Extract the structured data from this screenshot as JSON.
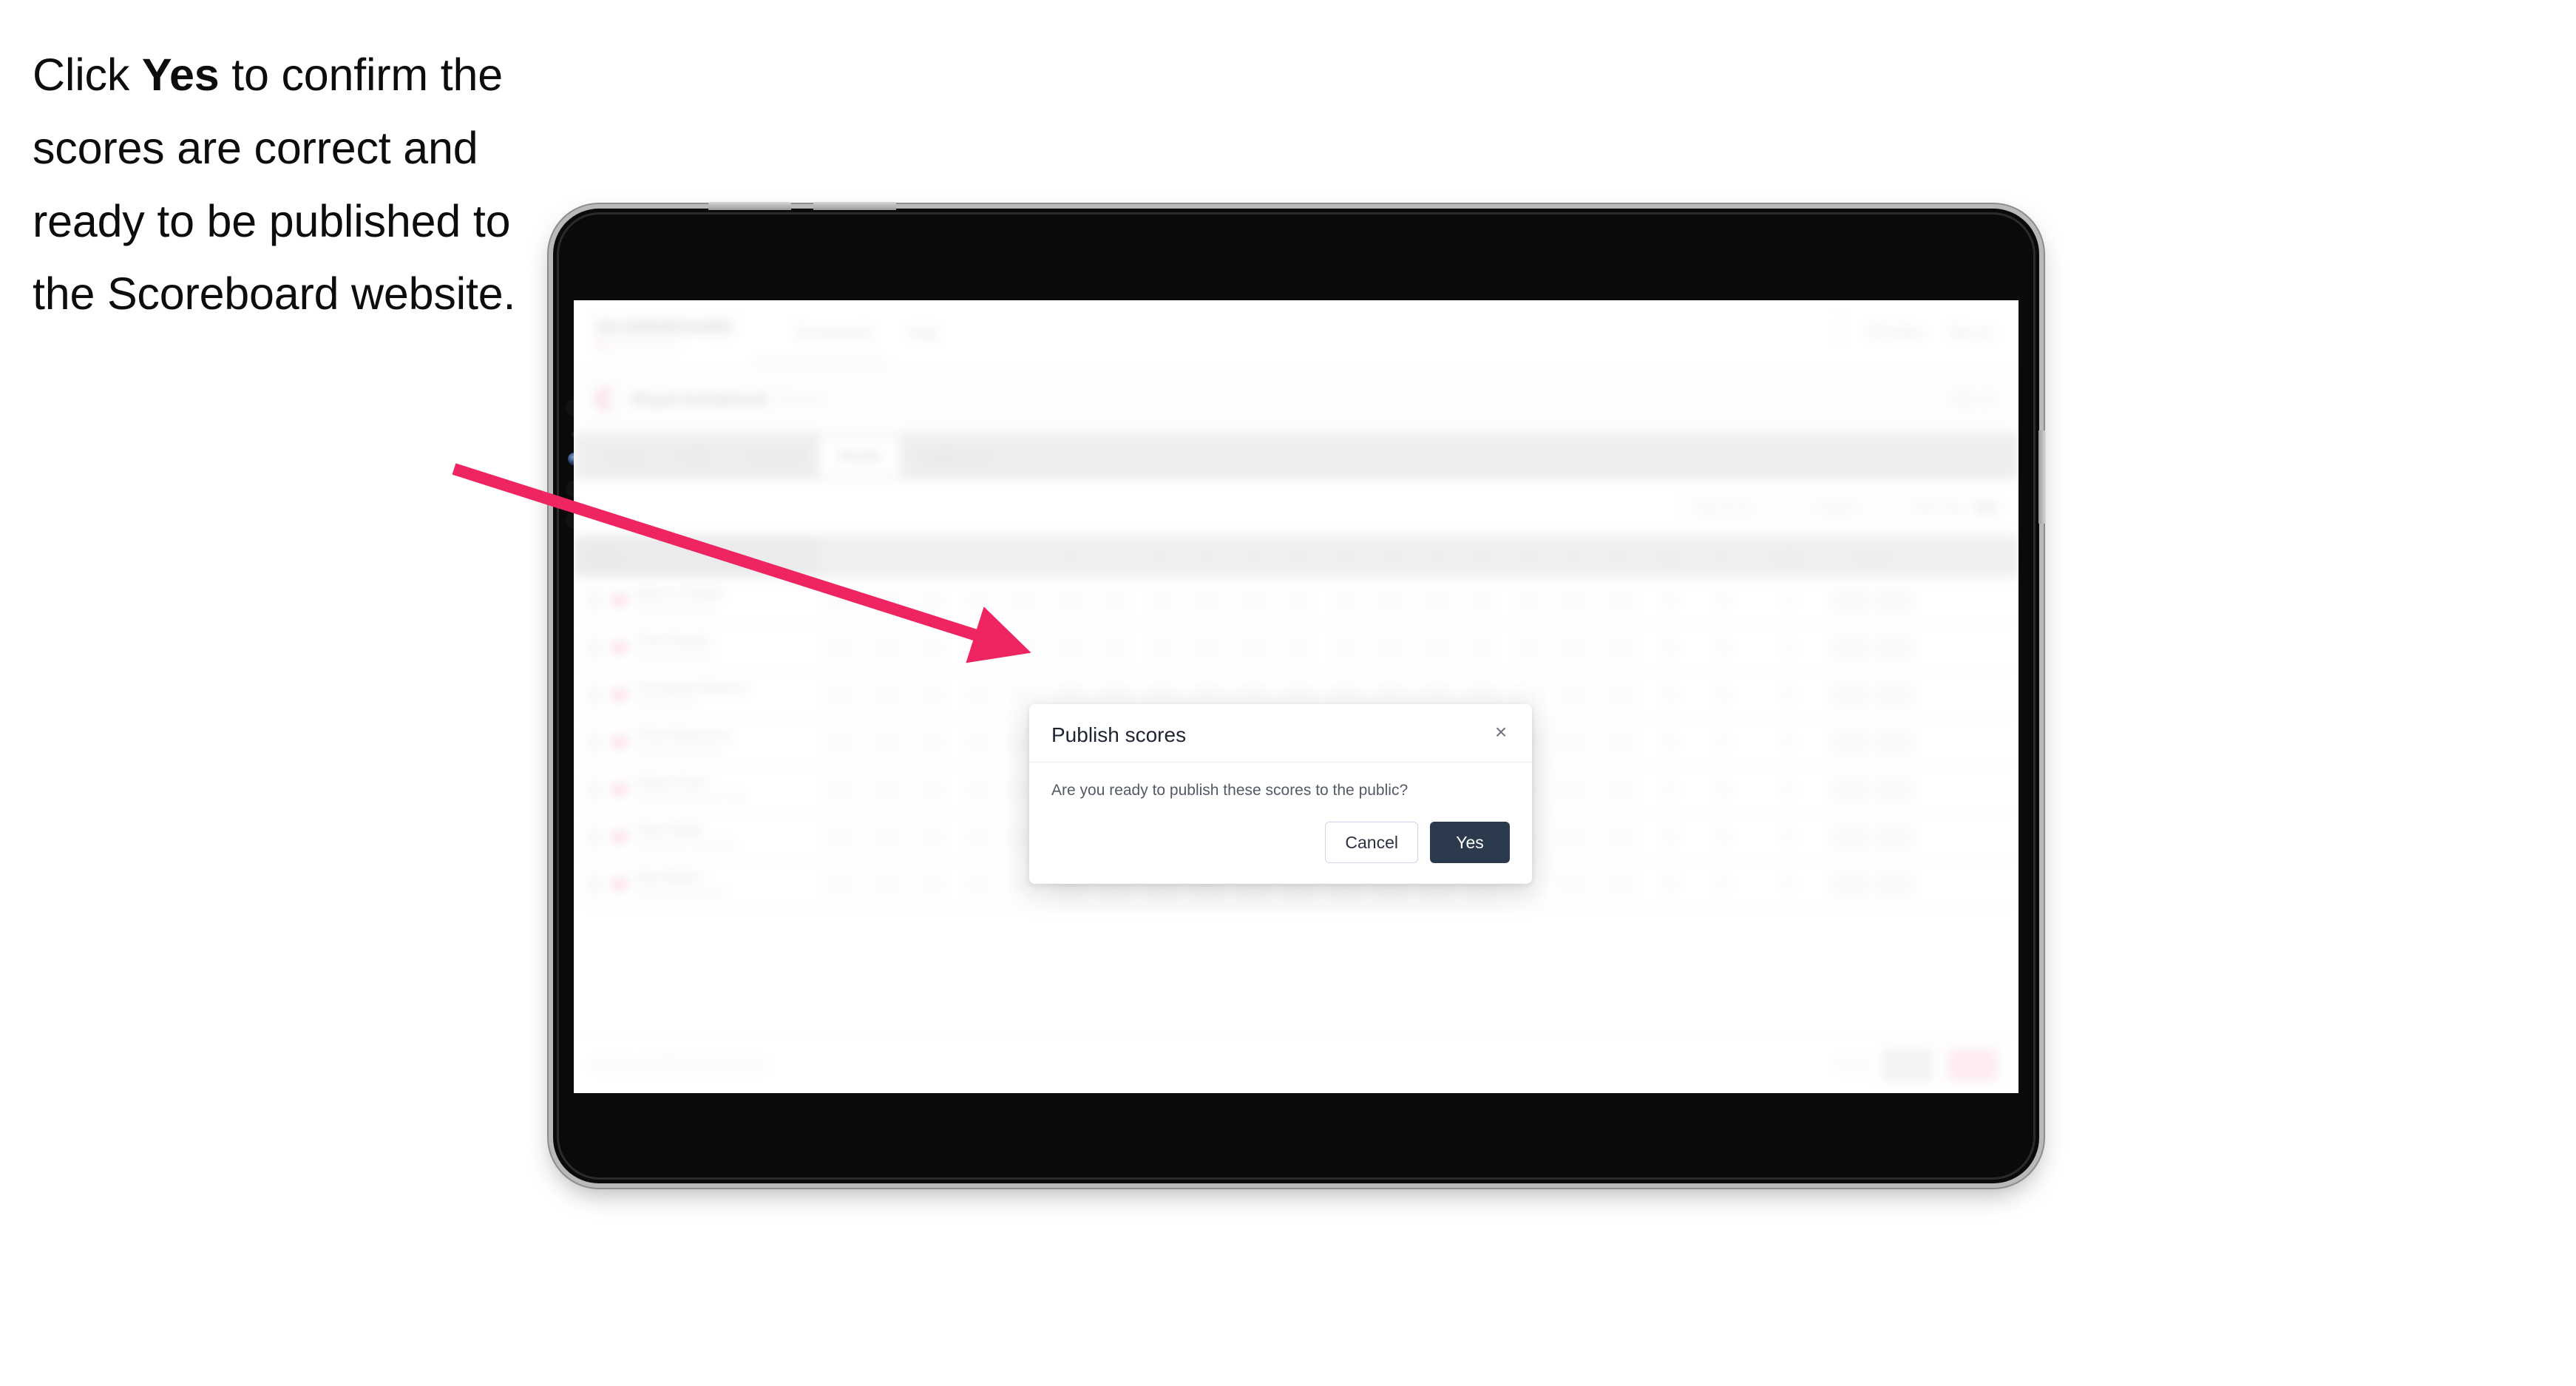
{
  "caption": {
    "pre": "Click ",
    "bold": "Yes",
    "post": " to confirm the scores are correct and ready to be published to the Scoreboard website."
  },
  "arrow": {
    "color": "#ee2560"
  },
  "device": {
    "type": "tablet"
  },
  "app": {
    "brand": {
      "mark": "SCOREBOARD",
      "sub": "live golf scoring"
    },
    "nav_links": [
      {
        "label": "Tournaments"
      },
      {
        "label": "Help"
      }
    ],
    "nav_right": [
      {
        "label": "Wil Galley"
      },
      {
        "label": "Sign out"
      }
    ],
    "event": {
      "title": "Royal Invitational",
      "subtitle": "Round 2",
      "right": "Hole 18"
    },
    "tabs": [
      {
        "label": "Setup",
        "active": false
      },
      {
        "label": "Field",
        "active": false
      },
      {
        "label": "Tee times",
        "active": false
      },
      {
        "label": "Results",
        "active": true
      },
      {
        "label": "Leaderboard",
        "active": false
      }
    ],
    "filters": [
      {
        "label": "Filter by tee",
        "type": "select"
      },
      {
        "label": "Round 2",
        "type": "select"
      },
      {
        "label": "Show only",
        "type": "toggle"
      }
    ],
    "table": {
      "headers": {
        "player": "Player",
        "holes": [
          "1",
          "2",
          "3",
          "4",
          "5",
          "6",
          "7",
          "8",
          "9",
          "10",
          "11",
          "12",
          "13",
          "14",
          "15",
          "16",
          "17",
          "18"
        ],
        "out": "Out",
        "in": "In",
        "points": "Points",
        "total": "Scores"
      },
      "rows": [
        {
          "name": "Marcus Temple",
          "club": "Pinehurst Country",
          "holes": [
            "4",
            "3",
            "5",
            "4",
            "",
            "",
            "",
            "",
            "",
            "",
            "",
            "",
            "",
            "",
            "",
            "",
            "",
            ""
          ],
          "out": "36",
          "in": "35",
          "points": "71",
          "total_a": "71",
          "total_b": "-1"
        },
        {
          "name": "Theo Renald",
          "club": "Prospect Heights",
          "holes": [
            "4",
            "5",
            "4",
            "4",
            "",
            "",
            "",
            "",
            "",
            "",
            "",
            "",
            "",
            "",
            "",
            "",
            "",
            ""
          ],
          "out": "36",
          "in": "35",
          "points": "71",
          "total_a": "71",
          "total_b": "-1"
        },
        {
          "name": "Cassandra Roberts",
          "club": "Redlake Park",
          "holes": [
            "5",
            "4",
            "4",
            "3",
            "",
            "",
            "",
            "",
            "",
            "",
            "",
            "",
            "",
            "",
            "",
            "",
            "",
            ""
          ],
          "out": "36",
          "in": "36",
          "points": "72",
          "total_a": "72",
          "total_b": "E"
        },
        {
          "name": "Chris Robertson",
          "club": "Northfield Golf Club",
          "holes": [
            "4",
            "4",
            "5",
            "4",
            "3",
            "4",
            "",
            "",
            "4",
            "",
            "",
            "",
            "",
            "",
            "",
            "",
            "",
            ""
          ],
          "out": "36",
          "in": "37",
          "points": "73",
          "total_a": "73",
          "total_b": "+1"
        },
        {
          "name": "Elaine Grant",
          "club": "Southwood Country Club",
          "holes": [
            "4",
            "4",
            "4",
            "5",
            "4",
            "4",
            "",
            "",
            "4",
            "",
            "",
            "",
            "",
            "",
            "",
            "",
            "",
            ""
          ],
          "out": "37",
          "in": "36",
          "points": "73",
          "total_a": "73",
          "total_b": "+1"
        },
        {
          "name": "Ryan Webb",
          "club": "Brookhaven Golf Links",
          "holes": [
            "5",
            "4",
            "4",
            "4",
            "4",
            "4",
            "",
            "",
            "4",
            "",
            "",
            "",
            "",
            "",
            "",
            "",
            "",
            ""
          ],
          "out": "38",
          "in": "36",
          "points": "74",
          "total_a": "74",
          "total_b": "+2"
        },
        {
          "name": "Bob Walker",
          "club": "Greenview Fairways",
          "holes": [
            "4",
            "5",
            "4",
            "4",
            "4",
            "4",
            "",
            "",
            "4",
            "",
            "",
            "",
            "",
            "",
            "",
            "",
            "",
            ""
          ],
          "out": "38",
          "in": "37",
          "points": "75",
          "total_a": "75",
          "total_b": "+3"
        }
      ]
    },
    "footer": {
      "note": "Results unconfirmed for round two",
      "text_action": "Reset",
      "gray_action": "Save",
      "pink_action": "Confirm and publish scores"
    }
  },
  "modal": {
    "title": "Publish scores",
    "message": "Are you ready to publish these scores to the public?",
    "close_label": "×",
    "cancel_label": "Cancel",
    "yes_label": "Yes",
    "yes_color": "#2c3a4e"
  }
}
